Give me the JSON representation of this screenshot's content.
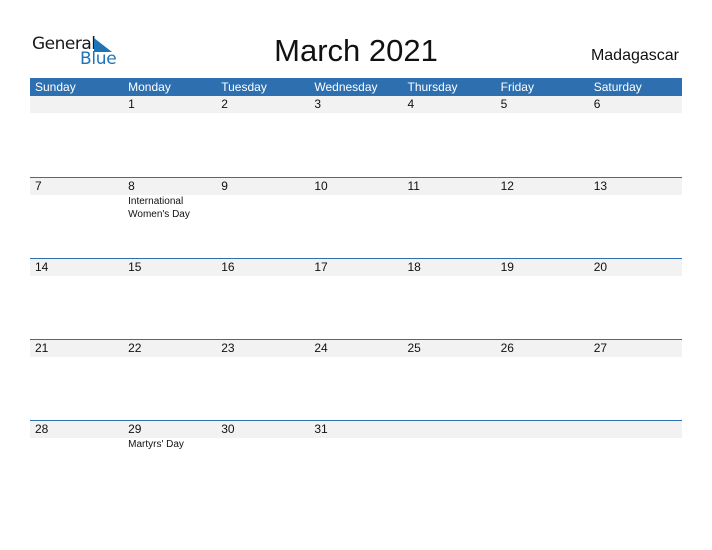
{
  "logo": {
    "word1": "General",
    "word2": "Blue",
    "icon": "triangle-flag-icon"
  },
  "title": "March 2021",
  "country": "Madagascar",
  "colors": {
    "header_bg": "#2e6fb0",
    "day_bar_bg": "#f2f2f2",
    "brand_blue": "#1f74b8"
  },
  "weekdays": [
    "Sunday",
    "Monday",
    "Tuesday",
    "Wednesday",
    "Thursday",
    "Friday",
    "Saturday"
  ],
  "weeks": [
    {
      "days": [
        "",
        "1",
        "2",
        "3",
        "4",
        "5",
        "6"
      ],
      "events": [
        "",
        "",
        "",
        "",
        "",
        "",
        ""
      ]
    },
    {
      "days": [
        "7",
        "8",
        "9",
        "10",
        "11",
        "12",
        "13"
      ],
      "events": [
        "",
        "International Women's Day",
        "",
        "",
        "",
        "",
        ""
      ]
    },
    {
      "days": [
        "14",
        "15",
        "16",
        "17",
        "18",
        "19",
        "20"
      ],
      "events": [
        "",
        "",
        "",
        "",
        "",
        "",
        ""
      ]
    },
    {
      "days": [
        "21",
        "22",
        "23",
        "24",
        "25",
        "26",
        "27"
      ],
      "events": [
        "",
        "",
        "",
        "",
        "",
        "",
        ""
      ]
    },
    {
      "days": [
        "28",
        "29",
        "30",
        "31",
        "",
        "",
        ""
      ],
      "events": [
        "",
        "Martyrs' Day",
        "",
        "",
        "",
        "",
        ""
      ]
    }
  ]
}
